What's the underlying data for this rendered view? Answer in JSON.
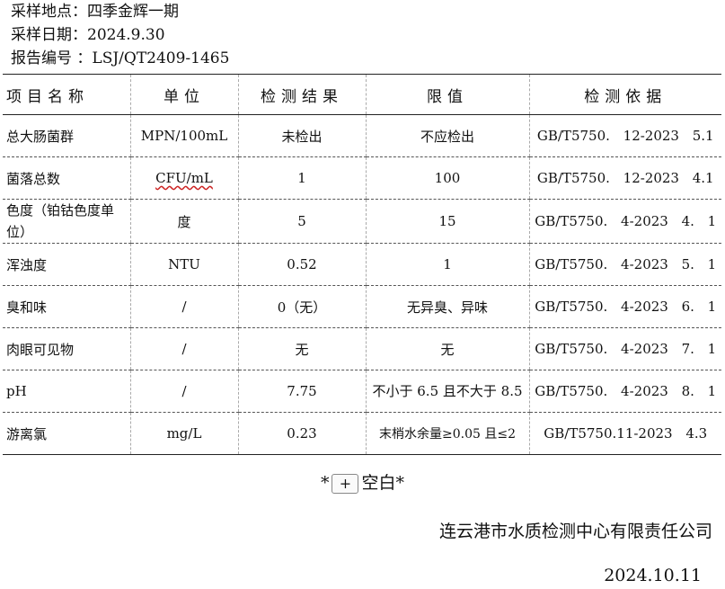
{
  "meta": {
    "location": "采样地点：四季金辉一期",
    "date": "采样日期：2024.9.30",
    "report_no": "报告编号 ：LSJ/QT2409-1465"
  },
  "table": {
    "headers": [
      "项目名称",
      "单位",
      "检测结果",
      "限值",
      "检测依据"
    ],
    "rows": [
      {
        "item": "总大肠菌群",
        "unit": "MPN/100mL",
        "result": "未检出",
        "limit": "不应检出",
        "basis": "GB/T5750. 12-2023 5.1"
      },
      {
        "item": "菌落总数",
        "unit": "CFU/mL",
        "result": "1",
        "limit": "100",
        "basis": "GB/T5750. 12-2023 4.1"
      },
      {
        "item": "色度（铂钴色度单位）",
        "unit": "度",
        "result": "5",
        "limit": "15",
        "basis": "GB/T5750. 4-2023 4. 1"
      },
      {
        "item": "浑浊度",
        "unit": "NTU",
        "result": "0.52",
        "limit": "1",
        "basis": "GB/T5750. 4-2023 5. 1"
      },
      {
        "item": "臭和味",
        "unit": "/",
        "result": "0（无）",
        "limit": "无异臭、异味",
        "basis": "GB/T5750. 4-2023 6. 1"
      },
      {
        "item": "肉眼可见物",
        "unit": "/",
        "result": "无",
        "limit": "无",
        "basis": "GB/T5750. 4-2023 7. 1"
      },
      {
        "item": "pH",
        "unit": "/",
        "result": "7.75",
        "limit": "不小于 6.5 且不大于 8.5",
        "basis": "GB/T5750. 4-2023 8. 1"
      },
      {
        "item": "游离氯",
        "unit": "mg/L",
        "result": "0.23",
        "limit": "末梢水余量≥0.05 且≤2",
        "basis": "GB/T5750.11-2023 4.3"
      }
    ]
  },
  "blank": {
    "prefix": "*",
    "plus": "+",
    "text": "空白*"
  },
  "issuer": "连云港市水质检测中心有限责任公司",
  "issue_date": "2024.10.11"
}
